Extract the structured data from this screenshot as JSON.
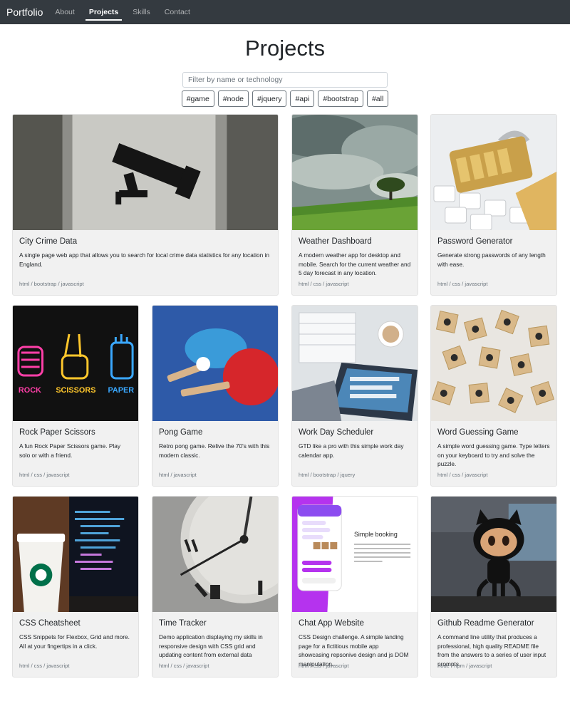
{
  "nav": {
    "brand": "Portfolio",
    "links": [
      "About",
      "Projects",
      "Skills",
      "Contact"
    ],
    "active": "Projects"
  },
  "page_title": "Projects",
  "filter": {
    "placeholder": "Filter by name or technology",
    "value": ""
  },
  "tags": [
    "#game",
    "#node",
    "#jquery",
    "#api",
    "#bootstrap",
    "#all"
  ],
  "projects": [
    {
      "title": "City Crime Data",
      "desc": "A single page web app that allows you to search for local crime data statistics for any location in England.",
      "tech": "html / bootstrap / javascript",
      "image": "cctv-camera-graffiti"
    },
    {
      "title": "Weather Dashboard",
      "desc": "A modern weather app for desktop and mobile. Search for the current weather and 5 day forecast in any location.",
      "tech": "html / css / javascript",
      "image": "tree-under-stormy-sky"
    },
    {
      "title": "Password Generator",
      "desc": "Generate strong passwords of any length with ease.",
      "tech": "html / css / javascript",
      "image": "padlock-on-keyboard"
    },
    {
      "title": "Rock Paper Scissors",
      "desc": "A fun Rock Paper Scissors game. Play solo or with a friend.",
      "tech": "html / css / javascript",
      "image": "neon-rock-scissors-paper-hands",
      "neon_labels": [
        "ROCK",
        "SCISSORS",
        "PAPER"
      ]
    },
    {
      "title": "Pong Game",
      "desc": "Retro pong game. Relive the 70's with this modern classic.",
      "tech": "html / javascript",
      "image": "ping-pong-paddles"
    },
    {
      "title": "Work Day Scheduler",
      "desc": "GTD like a pro with this simple work day calendar app.",
      "tech": "html / bootstrap / jquery",
      "image": "planner-and-laptop"
    },
    {
      "title": "Word Guessing Game",
      "desc": "A simple word guessing game. Type letters on your keyboard to try and solve the puzzle.",
      "tech": "html / css / javascript",
      "image": "scrabble-tiles"
    },
    {
      "title": "CSS Cheatsheet",
      "desc": "CSS Snippets for Flexbox, Grid and more. All at your fingertips in a click.",
      "tech": "html / css / javascript",
      "image": "coffee-cup-and-code"
    },
    {
      "title": "Time Tracker",
      "desc": "Demo application displaying my skills in responsive design with CSS grid and updating content from external data",
      "tech": "html / css / javascript",
      "image": "clock-face"
    },
    {
      "title": "Chat App Website",
      "desc": "CSS Design challenge. A simple landing page for a fictitious mobile app showcasing repsonive design and js DOM manipulation.",
      "tech": "html / css / javascript",
      "image": "chat-app-screenshot",
      "screenshot_heading": "Simple booking"
    },
    {
      "title": "Github Readme Generator",
      "desc": "A command line utility that produces a professional, high quality README file from the answers to a series of user input prompts.",
      "tech": "node / npm / javascript",
      "image": "octocat-figure"
    }
  ]
}
